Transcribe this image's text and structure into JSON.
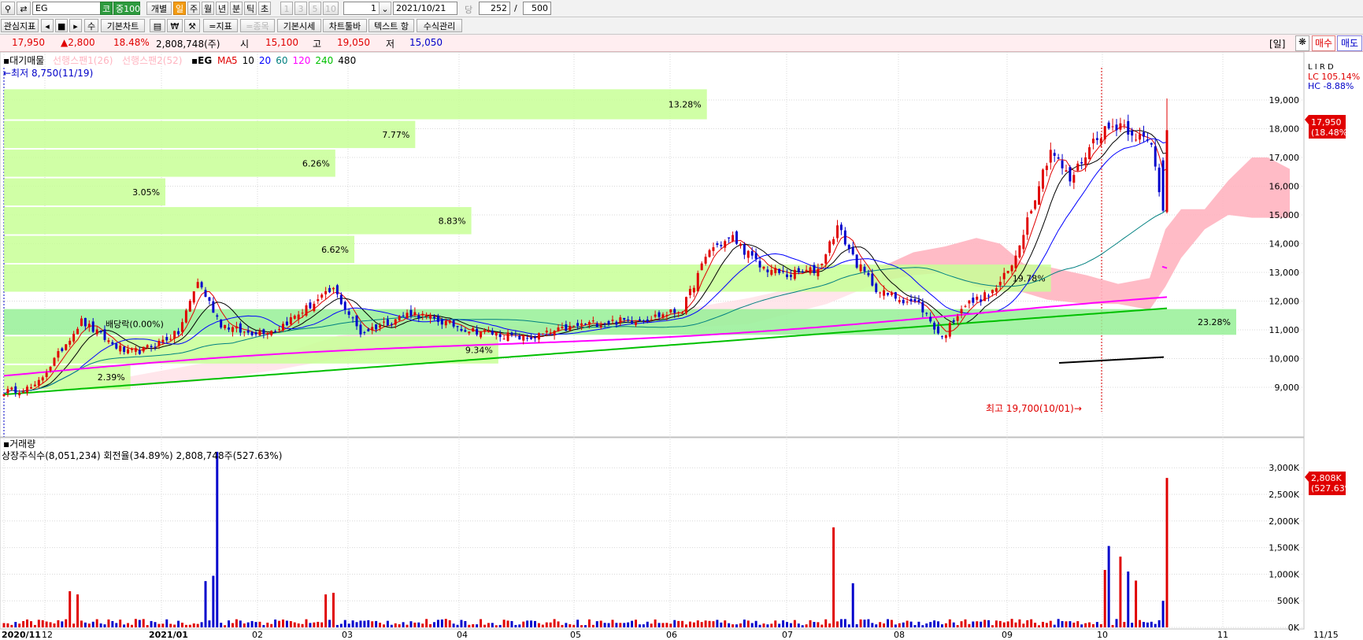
{
  "toolbar": {
    "stock_code": "EG",
    "market_badge": "코",
    "index_badge": "중100",
    "individual_label": "개별",
    "period_tabs": [
      "일",
      "주",
      "월",
      "년",
      "분",
      "틱",
      "초"
    ],
    "minute_options": [
      "1",
      "3",
      "5",
      "10"
    ],
    "count_value": "1",
    "date_value": "2021/10/21",
    "per_label": "당",
    "display_count": "252",
    "slash": "/",
    "total_count": "500",
    "interest_indicator": "관심지표",
    "nav_prev": "◂",
    "nav_stop": "■",
    "nav_next": "▸",
    "modify": "수",
    "basic_chart": "기본차트",
    "won_label": "₩",
    "add_indicator": "=지표",
    "add_item": "=종목",
    "basic_price": "기본시세",
    "chart_toolbar": "차트툴바",
    "text_label": "텍스트 항",
    "formula_manage": "수식관리"
  },
  "price_bar": {
    "close": "17,950",
    "change": "▲2,800",
    "change_pct": "18.48%",
    "volume": "2,808,748(주)",
    "open_label": "시",
    "open": "15,100",
    "high_label": "고",
    "high": "19,050",
    "low_label": "저",
    "low": "15,050",
    "period_badge": "[일]",
    "buy_label": "매수",
    "sell_label": "매도"
  },
  "legend": {
    "vp_label": "대기매물",
    "span1_label": "선행스팬1(26)",
    "span2_label": "선행스팬2(52)",
    "code": "EG",
    "ma_label": "MA",
    "ma_periods": [
      "5",
      "10",
      "20",
      "60",
      "120",
      "240",
      "480"
    ],
    "ma_colors": [
      "#e00000",
      "#000000",
      "#0000ff",
      "#008080",
      "#ff00ff",
      "#00c000",
      "#000000"
    ],
    "min_note": "←최저 8,750(11/19)",
    "max_note": "최고 19,700(10/01)→",
    "lc_label": "LC 105.14%",
    "hc_label": "HC -8.88%",
    "panel_flags": "L I R D"
  },
  "volume_panel": {
    "title": "거래량",
    "info": "상장주식수(8,051,234) 회전율(34.89%) 2,808,748주(527.63%)",
    "badge_value": "2,808K",
    "badge_pct": "(527.63%)"
  },
  "price_badge": {
    "value": "17,950",
    "pct": "(18.48%)"
  },
  "colors": {
    "up": "#e00000",
    "down": "#0000cc",
    "volume_profile": "#c8ff96",
    "volume_profile_max": "#96f096",
    "cloud": "#ffb4c0"
  },
  "chart_data": [
    {
      "type": "candlestick",
      "y_ticks": [
        9000,
        10000,
        11000,
        12000,
        13000,
        14000,
        15000,
        16000,
        17000,
        18000,
        19000
      ],
      "y_tick_labels": [
        "9,000",
        "10,000",
        "11,000",
        "12,000",
        "13,000",
        "14,000",
        "15,000",
        "16,000",
        "17,000",
        "18,000",
        "19,000"
      ],
      "ylim": [
        8300,
        20000
      ],
      "x_labels": [
        "2020/11",
        "12",
        "2021/01",
        "02",
        "03",
        "04",
        "05",
        "06",
        "07",
        "08",
        "09",
        "10",
        "11",
        "11/15"
      ],
      "candles_start": "2020-11-02",
      "anchors": [
        [
          0,
          8850
        ],
        [
          8,
          9000
        ],
        [
          20,
          11300
        ],
        [
          28,
          10500
        ],
        [
          32,
          10200
        ],
        [
          36,
          10300
        ],
        [
          45,
          10900
        ],
        [
          50,
          12700
        ],
        [
          56,
          11200
        ],
        [
          62,
          10900
        ],
        [
          70,
          11000
        ],
        [
          85,
          12400
        ],
        [
          92,
          10900
        ],
        [
          105,
          11600
        ],
        [
          120,
          11000
        ],
        [
          135,
          10700
        ],
        [
          150,
          11200
        ],
        [
          166,
          11400
        ],
        [
          175,
          11700
        ],
        [
          182,
          13800
        ],
        [
          188,
          14200
        ],
        [
          195,
          13200
        ],
        [
          202,
          12900
        ],
        [
          210,
          13100
        ],
        [
          215,
          14600
        ],
        [
          220,
          13300
        ],
        [
          226,
          12300
        ],
        [
          236,
          11900
        ],
        [
          242,
          10700
        ],
        [
          247,
          11800
        ],
        [
          255,
          12300
        ],
        [
          260,
          13200
        ],
        [
          266,
          15700
        ],
        [
          270,
          17300
        ],
        [
          275,
          16200
        ],
        [
          282,
          17800
        ],
        [
          288,
          18200
        ],
        [
          292,
          17800
        ],
        [
          296,
          17400
        ],
        [
          299,
          15150
        ],
        [
          300,
          17950
        ]
      ],
      "volume_profile": [
        {
          "price_low": 18300,
          "price_high": 19400,
          "pct": 13.28
        },
        {
          "price_low": 17300,
          "price_high": 18300,
          "pct": 7.77
        },
        {
          "price_low": 16300,
          "price_high": 17300,
          "pct": 6.26
        },
        {
          "price_low": 15300,
          "price_high": 16300,
          "pct": 3.05
        },
        {
          "price_low": 14300,
          "price_high": 15300,
          "pct": 8.83
        },
        {
          "price_low": 13300,
          "price_high": 14300,
          "pct": 6.62
        },
        {
          "price_low": 12300,
          "price_high": 13300,
          "pct": 19.78
        },
        {
          "price_low": 10800,
          "price_high": 11750,
          "pct": 23.28
        },
        {
          "price_low": 9800,
          "price_high": 10800,
          "pct": 9.34
        },
        {
          "price_low": 8900,
          "price_high": 9800,
          "pct": 2.39
        }
      ],
      "volume_profile_labels": [
        "13.28%",
        "7.77%",
        "6.26%",
        "3.05%",
        "8.83%",
        "6.62%",
        "19.78%",
        "23.28%",
        "9.34%",
        "2.39%"
      ],
      "annotations": [
        "배당락(0.00%)"
      ],
      "last": {
        "open": 15100,
        "high": 19050,
        "low": 15050,
        "close": 17950
      }
    },
    {
      "type": "bar",
      "name": "volume",
      "y_tick_labels": [
        "0K",
        "500K",
        "1,000K",
        "1,500K",
        "2,000K",
        "2,500K",
        "3,000K"
      ],
      "ylim": [
        0,
        3300000
      ],
      "spikes": [
        [
          17,
          680000
        ],
        [
          19,
          620000
        ],
        [
          52,
          870000
        ],
        [
          54,
          970000
        ],
        [
          55,
          3300000
        ],
        [
          83,
          620000
        ],
        [
          85,
          650000
        ],
        [
          214,
          1880000
        ],
        [
          219,
          830000
        ],
        [
          284,
          1080000
        ],
        [
          285,
          1530000
        ],
        [
          288,
          1330000
        ],
        [
          290,
          1050000
        ],
        [
          292,
          880000
        ],
        [
          299,
          500000
        ],
        [
          300,
          2808748
        ]
      ]
    }
  ]
}
